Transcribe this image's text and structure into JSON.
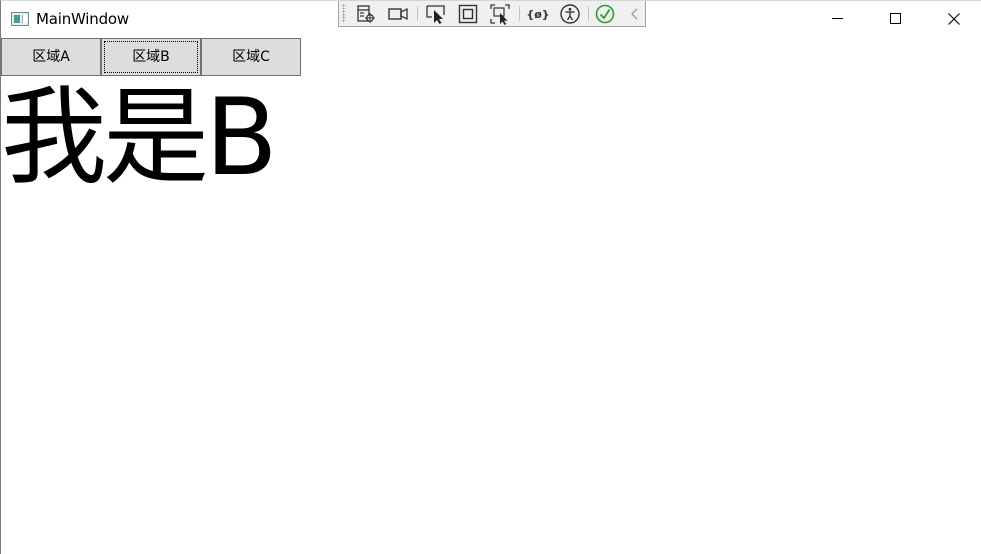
{
  "window": {
    "title": "MainWindow",
    "icon": "window-app-icon"
  },
  "caption_buttons": {
    "minimize": "minimize-icon",
    "maximize": "maximize-icon",
    "close": "close-icon"
  },
  "debug_toolbar": {
    "items": [
      {
        "name": "live-visual-tree-icon"
      },
      {
        "name": "record-icon"
      },
      {
        "name": "select-element-icon"
      },
      {
        "name": "display-layout-adorners-icon"
      },
      {
        "name": "track-focused-element-icon"
      },
      {
        "name": "binding-failures-icon"
      },
      {
        "name": "accessibility-icon"
      },
      {
        "name": "hot-reload-status-icon"
      },
      {
        "name": "collapse-toolbar-icon"
      }
    ],
    "status_color": "#2e9b2e"
  },
  "region_buttons": [
    {
      "label": "区域A"
    },
    {
      "label": "区域B",
      "focused": true
    },
    {
      "label": "区域C"
    }
  ],
  "content": {
    "text": "我是B"
  }
}
